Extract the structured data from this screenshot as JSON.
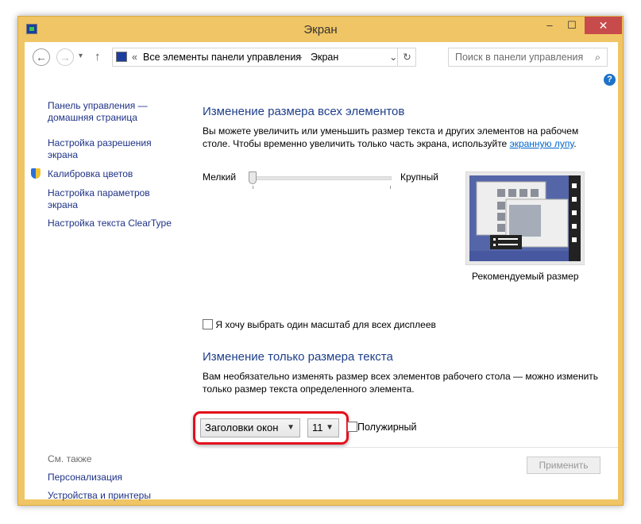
{
  "window": {
    "title": "Экран",
    "minimize": "‒",
    "maximize": "☐",
    "close": "✕"
  },
  "toolbar": {
    "back": "←",
    "forward": "→",
    "recent": "▾",
    "up": "↑",
    "breadcrumb": {
      "overflow": "«",
      "items": [
        "Все элементы панели управления",
        "Экран"
      ],
      "separator": "▸"
    },
    "dropdown": "⌄",
    "refresh": "↻",
    "search_placeholder": "Поиск в панели управления",
    "search_icon": "⌕",
    "help": "?"
  },
  "sidebar": {
    "items": [
      "Панель управления —\nдомашняя страница",
      "Настройка разрешения\nэкрана",
      "Калибровка цветов",
      "Настройка параметров\nэкрана",
      "Настройка текста ClearType"
    ],
    "see_also": "См. также",
    "see_also_items": [
      "Персонализация",
      "Устройства и принтеры"
    ]
  },
  "main": {
    "section1_title": "Изменение размера всех элементов",
    "section1_text": "Вы можете увеличить или уменьшить размер текста и других элементов на рабочем столе. Чтобы временно увеличить только часть экрана, используйте ",
    "magnifier_link": "экранную лупу",
    "section1_text_end": ".",
    "slider_min": "Мелкий",
    "slider_max": "Крупный",
    "slider_value": 0,
    "preview_caption": "Рекомендуемый размер",
    "one_scale_checkbox": "Я хочу выбрать один масштаб для всех дисплеев",
    "section2_title": "Изменение только размера текста",
    "section2_text": "Вам необязательно изменять размер всех элементов рабочего стола — можно изменить только размер текста определенного элемента.",
    "element_select": "Заголовки окон",
    "size_select": "11",
    "bold_checkbox": "Полужирный",
    "apply": "Применить"
  },
  "colors": {
    "highlight": "#e3101b",
    "link": "#1e3287",
    "heading": "#1e3f8a",
    "titlebar": "#f0c565"
  }
}
